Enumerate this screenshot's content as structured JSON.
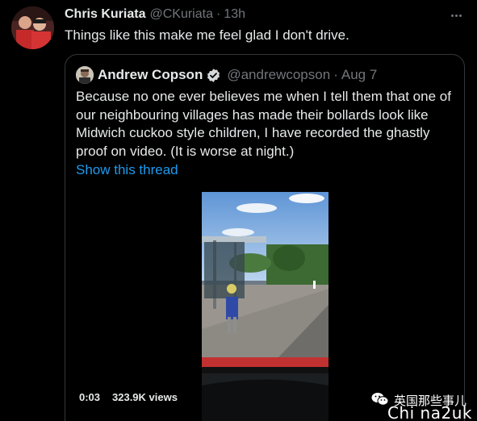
{
  "tweet": {
    "author_name": "Chris Kuriata",
    "author_handle": "@CKuriata",
    "separator": "·",
    "time": "13h",
    "text": "Things like this make me feel glad I don't drive."
  },
  "quoted_tweet": {
    "author_name": "Andrew Copson",
    "verified_icon": "verified-badge-icon",
    "author_handle": "@andrewcopson",
    "separator": "·",
    "time": "Aug 7",
    "text_lines": [
      "Because no one ever believes me when I tell them that one of",
      "our neighbouring villages has made their bollards look like",
      "Midwich cuckoo style children, I have recorded the ghastly",
      "proof on video. (It is worse at night.)"
    ],
    "show_thread_label": "Show this thread",
    "video": {
      "elapsed": "0:03",
      "views": "323.9K views"
    }
  },
  "watermark": {
    "icon": "wechat-icon",
    "cn_text": "英国那些事儿",
    "en_text": "Chi na2uk"
  },
  "colors": {
    "background": "#000000",
    "primary_text": "#e7e9ea",
    "secondary_text": "#71767b",
    "link": "#1d9bf0",
    "border": "#333639"
  }
}
